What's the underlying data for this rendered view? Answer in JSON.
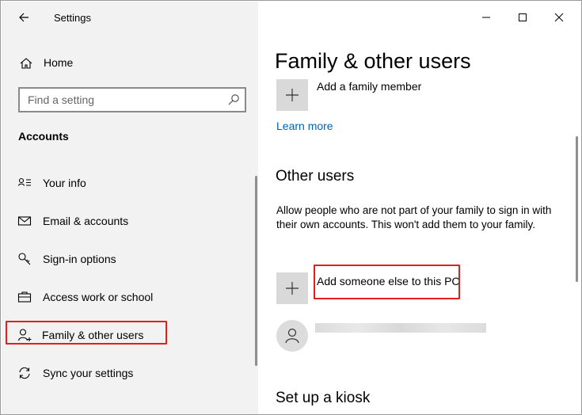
{
  "window": {
    "title": "Settings",
    "controls": {
      "minimize": "minimize-icon",
      "maximize": "maximize-icon",
      "close": "close-icon"
    }
  },
  "sidebar": {
    "home_label": "Home",
    "search": {
      "placeholder": "Find a setting",
      "icon": "search-icon"
    },
    "section_title": "Accounts",
    "items": [
      {
        "label": "Your info",
        "icon": "person-card-icon"
      },
      {
        "label": "Email & accounts",
        "icon": "mail-icon"
      },
      {
        "label": "Sign-in options",
        "icon": "key-icon"
      },
      {
        "label": "Access work or school",
        "icon": "briefcase-icon"
      },
      {
        "label": "Family & other users",
        "icon": "person-add-icon",
        "selected": true
      },
      {
        "label": "Sync your settings",
        "icon": "sync-icon"
      }
    ]
  },
  "main": {
    "title": "Family & other users",
    "add_family_label": "Add a family member",
    "learn_more": "Learn more",
    "other_users_heading": "Other users",
    "other_users_description": "Allow people who are not part of your family to sign in with their own accounts. This won't add them to your family.",
    "add_someone_label": "Add someone else to this PC",
    "kiosk_heading": "Set up a kiosk"
  },
  "colors": {
    "accent_link": "#0063b1",
    "highlight_box": "#e0201b",
    "sidebar_bg": "#f2f2f2",
    "tile_bg": "#d9d9d9"
  }
}
